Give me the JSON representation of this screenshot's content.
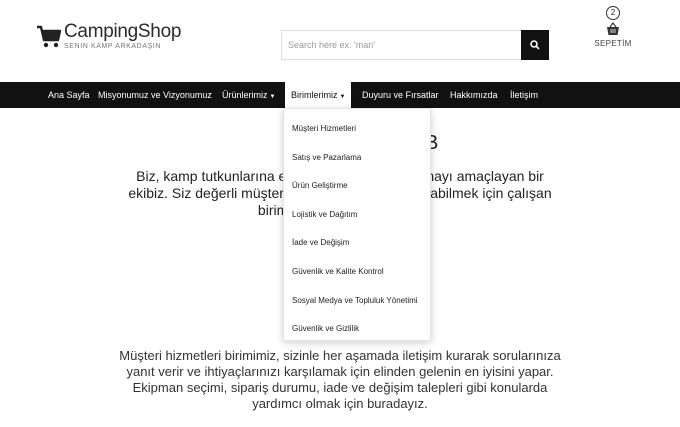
{
  "header": {
    "logo_title": "CampingShop",
    "logo_subtitle": "SENIN KAMP ARKADAŞIN",
    "search_placeholder": "Search here ex. 'man'",
    "basket_count": "2",
    "basket_label": "SEPETİM"
  },
  "nav": {
    "items": [
      {
        "label": "Ana Sayfa"
      },
      {
        "label": "Misyonumuz ve Vizyonumuz"
      },
      {
        "label": "Ürünlerimiz"
      },
      {
        "label": "Birimlerimiz"
      },
      {
        "label": "Duyuru ve Fırsatlar"
      },
      {
        "label": "Hakkımızda"
      },
      {
        "label": "İletişim"
      }
    ]
  },
  "dropdown": {
    "items": [
      "Müşteri Hizmetleri",
      "Satış ve Pazarlama",
      "Ürün Geliştirme",
      "Lojistik ve Dağıtım",
      "İade ve Değişim",
      "Güvenlik ve Kalite Kontrol",
      "Sosyal Medya ve Topluluk Yönetimi",
      "Güvenlik ve Gizlilik"
    ]
  },
  "content": {
    "heading_fragment": "B",
    "intro_line1": "Biz, kamp tutkunlarına en                                  nayı amaçlayan bir",
    "intro_line2": "ekibiz. Siz değerli müşterile                                  abilmek için çalışan",
    "intro_line3": "birimleri                          iz:",
    "description": "Müşteri hizmetleri birimimiz, sizinle her aşamada iletişim kurarak sorularınıza yanıt verir ve ihtiyaçlarınızı karşılamak için elinden gelenin en iyisini yapar. Ekipman seçimi, sipariş durumu, iade ve değişim talepleri gibi konularda yardımcı olmak için buradayız."
  },
  "colors": {
    "nav_bg": "#111111",
    "accent": "#111111"
  }
}
